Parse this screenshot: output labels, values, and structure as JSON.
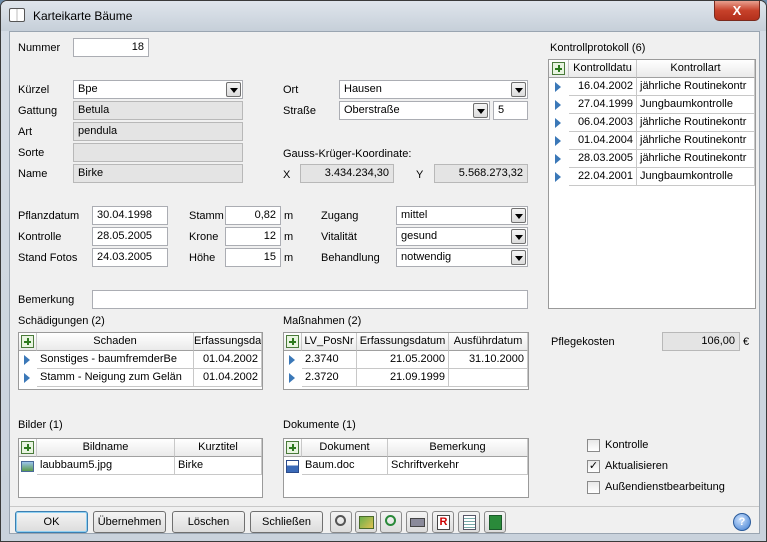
{
  "window": {
    "title": "Karteikarte Bäume",
    "close": "X"
  },
  "nummer": {
    "label": "Nummer",
    "value": "18"
  },
  "left_fields": {
    "kuerzel": {
      "label": "Kürzel",
      "value": "Bpe"
    },
    "gattung": {
      "label": "Gattung",
      "value": "Betula"
    },
    "art": {
      "label": "Art",
      "value": "pendula"
    },
    "sorte": {
      "label": "Sorte",
      "value": ""
    },
    "name": {
      "label": "Name",
      "value": "Birke"
    }
  },
  "location": {
    "ort": {
      "label": "Ort",
      "value": "Hausen"
    },
    "strasse": {
      "label": "Straße",
      "value": "Oberstraße",
      "number": "5"
    },
    "gk_label": "Gauss-Krüger-Koordinate:",
    "x_label": "X",
    "x_value": "3.434.234,30",
    "y_label": "Y",
    "y_value": "5.568.273,32"
  },
  "dates": {
    "pflanzdatum": {
      "label": "Pflanzdatum",
      "value": "30.04.1998"
    },
    "kontrolle": {
      "label": "Kontrolle",
      "value": "28.05.2005"
    },
    "standfotos": {
      "label": "Stand Fotos",
      "value": "24.03.2005"
    }
  },
  "measures": {
    "stamm": {
      "label": "Stamm",
      "value": "0,82",
      "unit": "m"
    },
    "krone": {
      "label": "Krone",
      "value": "12",
      "unit": "m"
    },
    "hoehe": {
      "label": "Höhe",
      "value": "15",
      "unit": "m"
    }
  },
  "status": {
    "zugang": {
      "label": "Zugang",
      "value": "mittel"
    },
    "vitalitaet": {
      "label": "Vitalität",
      "value": "gesund"
    },
    "behandlung": {
      "label": "Behandlung",
      "value": "notwendig"
    }
  },
  "bemerkung": {
    "label": "Bemerkung",
    "value": ""
  },
  "kontrollprotokoll": {
    "title": "Kontrollprotokoll (6)",
    "columns": [
      "Kontrolldatu",
      "Kontrollart"
    ],
    "rows": [
      [
        "16.04.2002",
        "jährliche Routinekontr"
      ],
      [
        "27.04.1999",
        "Jungbaumkontrolle"
      ],
      [
        "06.04.2003",
        "jährliche Routinekontr"
      ],
      [
        "01.04.2004",
        "jährliche Routinekontr"
      ],
      [
        "28.03.2005",
        "jährliche Routinekontr"
      ],
      [
        "22.04.2001",
        "Jungbaumkontrolle"
      ]
    ]
  },
  "schaedigungen": {
    "title": "Schädigungen (2)",
    "columns": [
      "Schaden",
      "Erfassungsdat"
    ],
    "rows": [
      [
        "Sonstiges - baumfremderBe",
        "01.04.2002"
      ],
      [
        "Stamm - Neigung zum Gelän",
        "01.04.2002"
      ]
    ]
  },
  "massnahmen": {
    "title": "Maßnahmen (2)",
    "columns": [
      "LV_PosNr",
      "Erfassungsdatum",
      "Ausführdatum"
    ],
    "rows": [
      [
        "2.3740",
        "21.05.2000",
        "31.10.2000"
      ],
      [
        "2.3720",
        "21.09.1999",
        ""
      ]
    ]
  },
  "pflegekosten": {
    "label": "Pflegekosten",
    "value": "106,00",
    "unit": "€"
  },
  "bilder": {
    "title": "Bilder (1)",
    "columns": [
      "Bildname",
      "Kurztitel"
    ],
    "rows": [
      [
        "laubbaum5.jpg",
        "Birke"
      ]
    ]
  },
  "dokumente": {
    "title": "Dokumente (1)",
    "columns": [
      "Dokument",
      "Bemerkung"
    ],
    "rows": [
      [
        "Baum.doc",
        "Schriftverkehr"
      ]
    ]
  },
  "checkboxes": [
    {
      "label": "Kontrolle",
      "checked": false
    },
    {
      "label": "Aktualisieren",
      "checked": true
    },
    {
      "label": "Außendienstbearbeitung",
      "checked": false
    }
  ],
  "buttons": {
    "ok": "OK",
    "uebernehmen": "Übernehmen",
    "loeschen": "Löschen",
    "schliessen": "Schließen"
  },
  "toolbar_icons": [
    "zoom-out-icon",
    "map-icon",
    "zoom-in-icon",
    "print-icon",
    "report-icon",
    "list-icon",
    "excel-icon"
  ],
  "help": "?"
}
